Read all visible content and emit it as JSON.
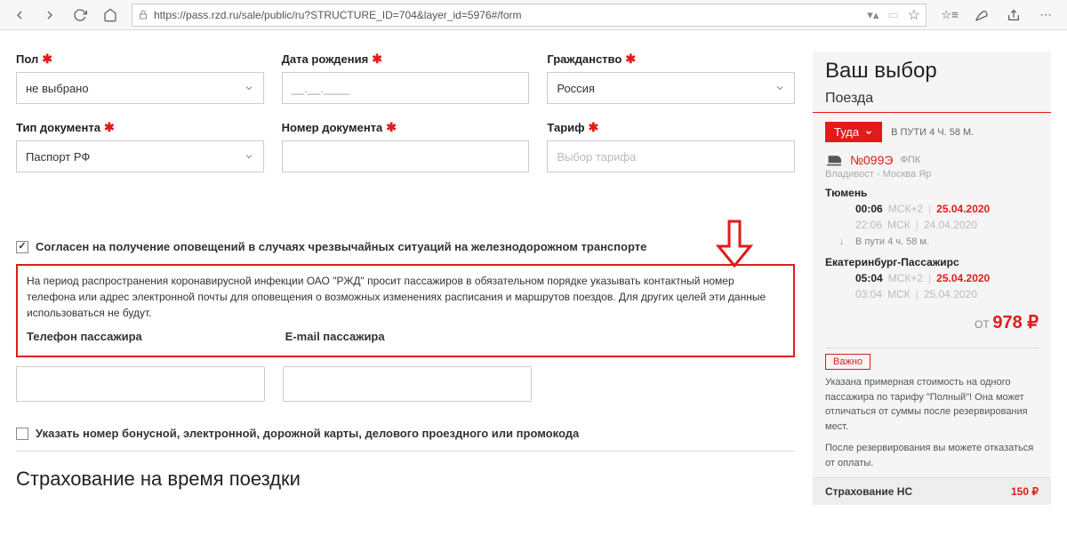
{
  "browser": {
    "url": "https://pass.rzd.ru/sale/public/ru?STRUCTURE_ID=704&layer_id=5976#/form"
  },
  "form": {
    "gender": {
      "label": "Пол",
      "value": "не выбрано"
    },
    "birthdate": {
      "label": "Дата рождения",
      "placeholder": "__.__.____"
    },
    "citizenship": {
      "label": "Гражданство",
      "value": "Россия"
    },
    "doc_type": {
      "label": "Тип документа",
      "value": "Паспорт РФ"
    },
    "doc_number": {
      "label": "Номер документа"
    },
    "tariff": {
      "label": "Тариф",
      "placeholder": "Выбор тарифа"
    },
    "consent_label": "Согласен на получение оповещений в случаях чрезвычайных ситуаций на железнодорожном транспорте",
    "notice": "На период распространения коронавирусной инфекции ОАО \"РЖД\" просит пассажиров в обязательном порядке указывать контактный номер телефона или адрес электронной почты для оповещения о возможных изменениях расписания и маршрутов поездов. Для других целей эти данные использоваться не будут.",
    "phone_label": "Телефон пассажира",
    "email_label": "E-mail пассажира",
    "bonus_label": "Указать номер бонусной, электронной, дорожной карты, делового проездного или промокода",
    "insurance_heading": "Страхование на время поездки"
  },
  "sidebar": {
    "title": "Ваш выбор",
    "subtitle": "Поезда",
    "direction": "Туда",
    "travel_time": "В ПУТИ 4 Ч. 58 М.",
    "train_no": "№099Э",
    "train_co": "ФПК",
    "route": "Владивост - Москва Яр",
    "station1": "Тюмень",
    "dep1_time": "00:06",
    "dep1_tz": "МСК+2",
    "dep1_date": "25.04.2020",
    "dep1b_time": "22:06",
    "dep1b_tz": "МСК",
    "dep1b_date": "24.04.2020",
    "travel_note": "В пути  4 ч. 58 м.",
    "station2": "Екатеринбург-Пассажирс",
    "arr_time": "05:04",
    "arr_tz": "МСК+2",
    "arr_date": "25.04.2020",
    "arrb_time": "03:04",
    "arrb_tz": "МСК",
    "arrb_date": "25.04.2020",
    "from_label": "ОТ",
    "price": "978 ₽",
    "important_label": "Важно",
    "important_text1": "Указана примерная стоимость на одного пассажира по тарифу \"Полный\"! Она может отличаться от суммы после резервирования мест.",
    "important_text2": "После резервирования вы можете отказаться от оплаты.",
    "insurance_label": "Страхование НС",
    "insurance_price": "150 ₽"
  }
}
